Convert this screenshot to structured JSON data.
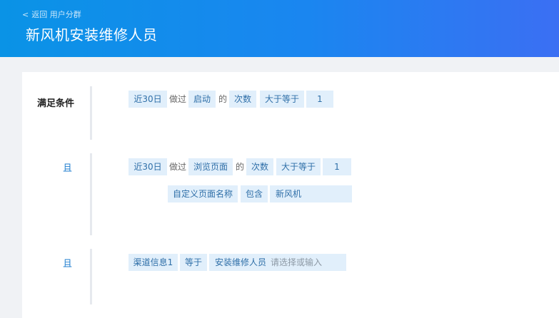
{
  "header": {
    "back_label": "返回",
    "breadcrumb": "用户分群",
    "title": "新风机安装维修人员"
  },
  "conditions": {
    "main_label": "满足条件",
    "and_label": "且",
    "group1": {
      "time_range": "近30日",
      "verb": "做过",
      "event": "启动",
      "of": "的",
      "metric": "次数",
      "operator": "大于等于",
      "value": "1"
    },
    "group2": {
      "time_range": "近30日",
      "verb": "做过",
      "event": "浏览页面",
      "of": "的",
      "metric": "次数",
      "operator": "大于等于",
      "value": "1",
      "filter": {
        "property": "自定义页面名称",
        "operator": "包含",
        "value": "新风机"
      }
    },
    "group3": {
      "property": "渠道信息1",
      "operator": "等于",
      "value": "安装维修人员",
      "placeholder": "请选择或输入"
    }
  }
}
